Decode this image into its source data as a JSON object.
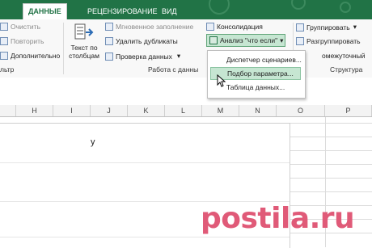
{
  "tabs": [
    "ДАННЫЕ",
    "РЕЦЕНЗИРОВАНИЕ",
    "ВИД"
  ],
  "left_group": {
    "buttons": [
      "Очистить",
      "Повторить",
      "Дополнительно"
    ],
    "label": "льтр"
  },
  "text_columns": {
    "line1": "Текст по",
    "line2": "столбцам"
  },
  "data_tools": {
    "flash_fill": "Мгновенное заполнение",
    "remove_duplicates": "Удалить дубликаты",
    "data_validation": "Проверка данных",
    "consolidate": "Консолидация",
    "what_if": "Анализ \"что если\"",
    "label": "Работа с данны"
  },
  "outline": {
    "group": "Группировать",
    "ungroup": "Разгруппировать",
    "subtotal": "омежуточный",
    "label": "Структура"
  },
  "whatif_menu": [
    "Диспетчер сценариев...",
    "Подбор параметра...",
    "Таблица данных..."
  ],
  "columns": [
    "H",
    "I",
    "J",
    "K",
    "L",
    "M",
    "N",
    "O",
    "P"
  ],
  "cell_text": "y",
  "watermark": "postila.ru",
  "colors": {
    "excel_green": "#217346",
    "highlight": "#c6e6d2",
    "watermark": "#e05a78"
  }
}
